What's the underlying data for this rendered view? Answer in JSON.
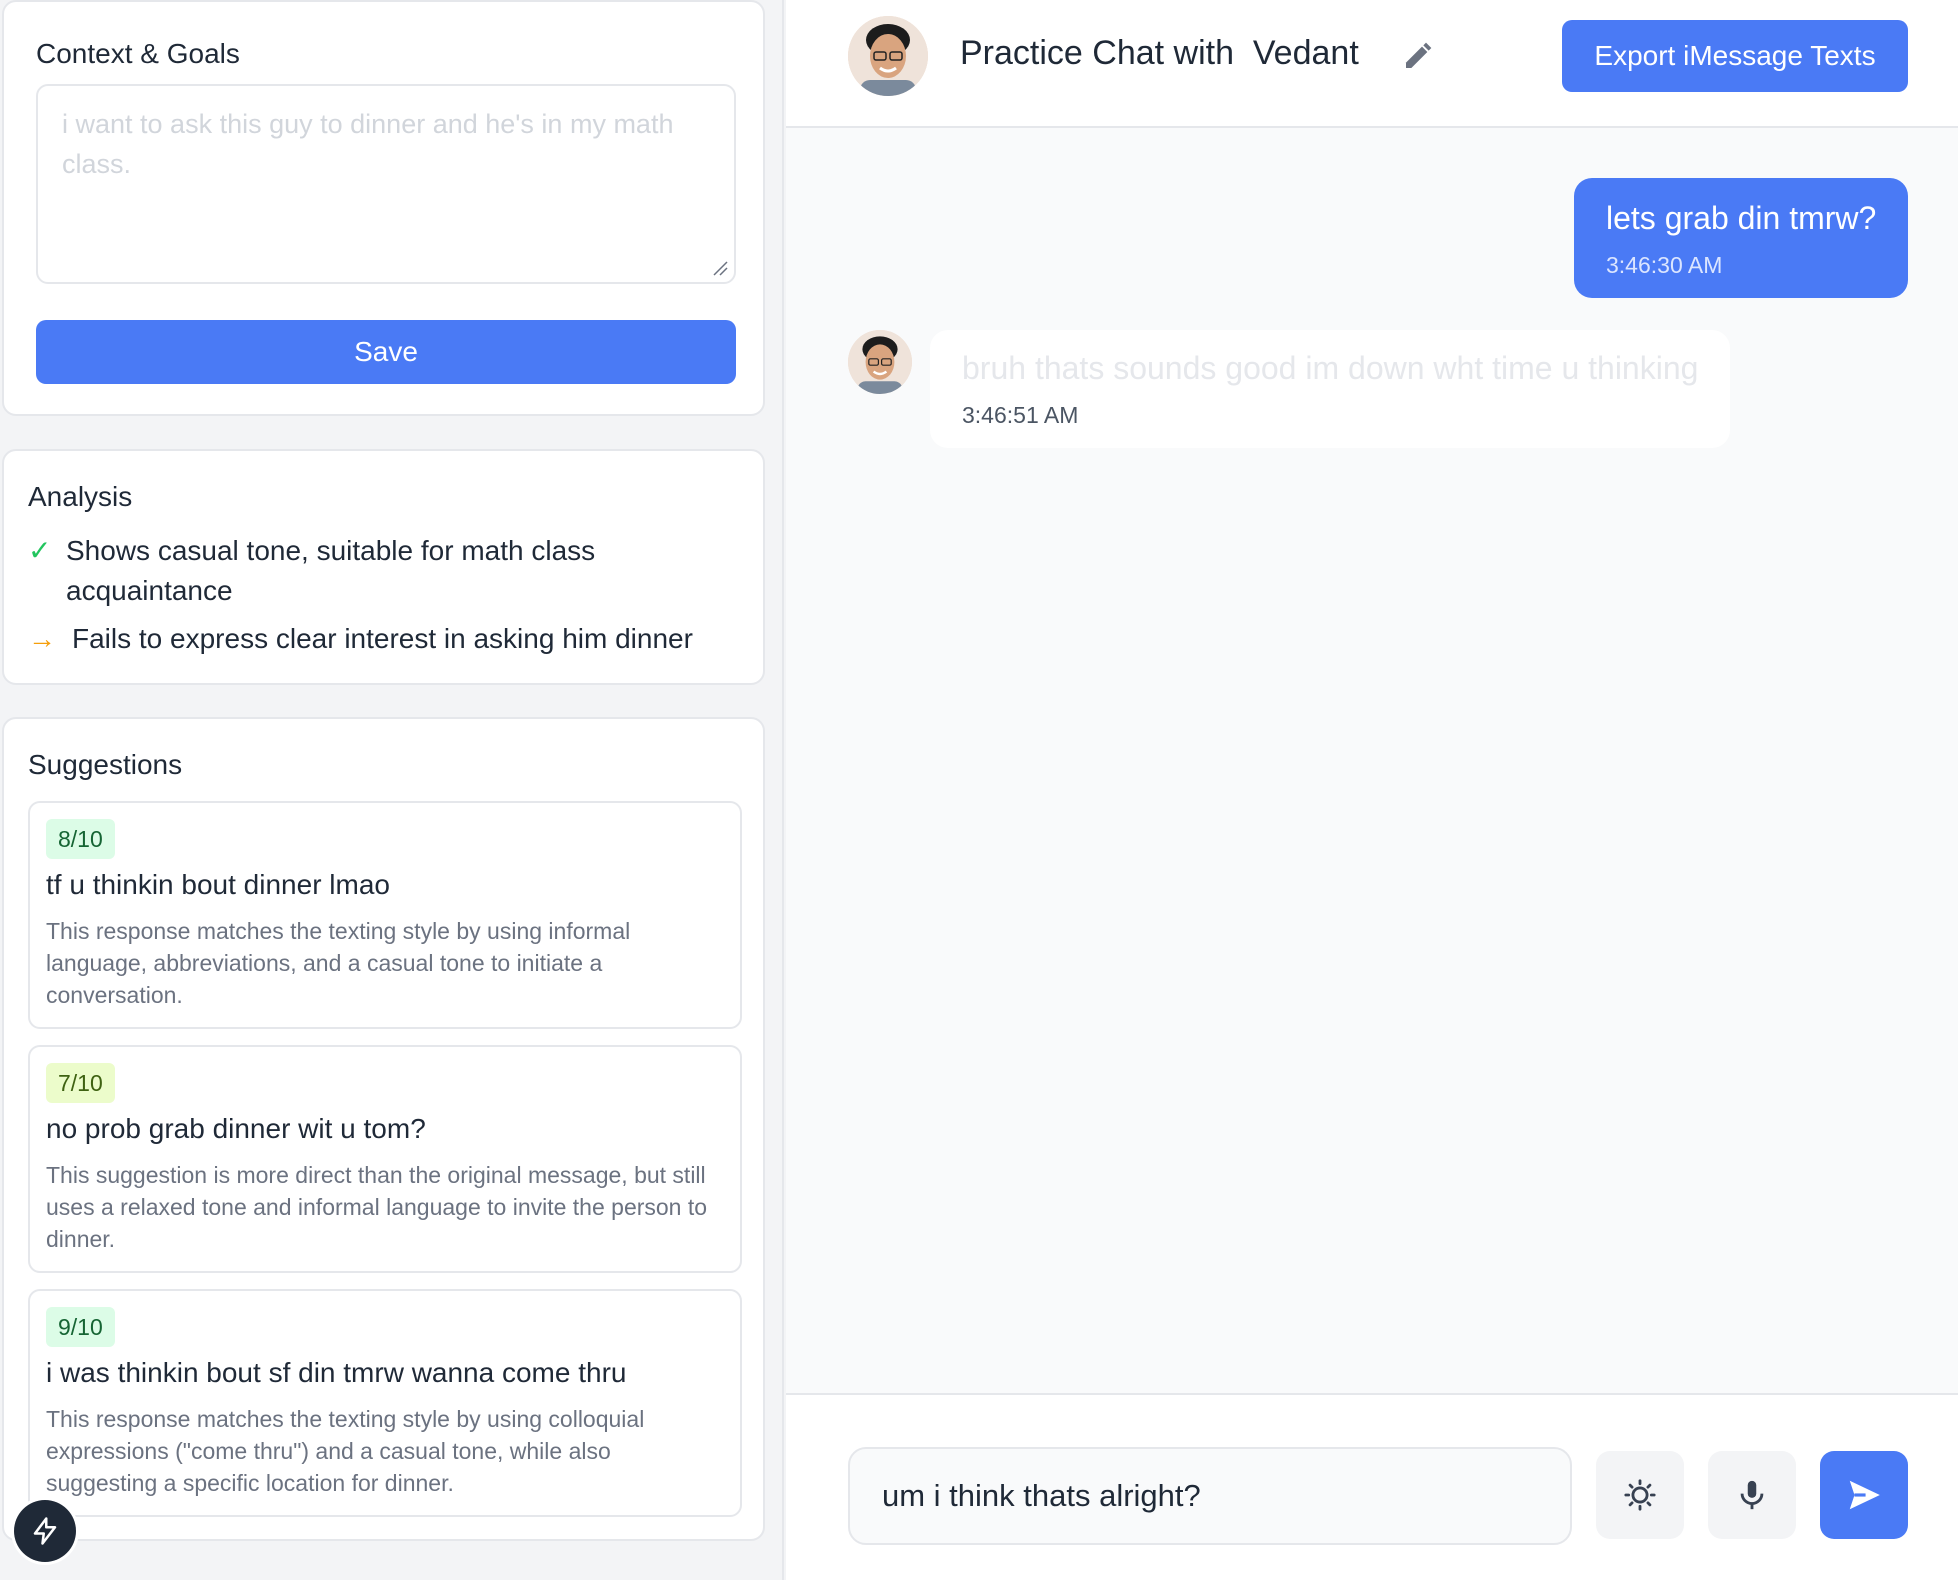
{
  "context": {
    "title": "Context & Goals",
    "placeholder": "i want to ask this guy to dinner and he's in my math class.",
    "value": "",
    "save_label": "Save"
  },
  "analysis": {
    "title": "Analysis",
    "items": [
      {
        "icon": "check-icon",
        "color": "#22c55e",
        "symbol": "✓",
        "text_line1": "Shows casual tone, suitable for math class",
        "text_line2": "acquaintance"
      },
      {
        "icon": "arrow-right-icon",
        "color": "#f59e0b",
        "symbol": "→",
        "text_line1": "Fails to express clear interest in asking him dinner"
      }
    ]
  },
  "suggestions": {
    "title": "Suggestions",
    "items": [
      {
        "score": "8/10",
        "text": "tf u thinkin bout dinner lmao",
        "description": "This response matches the texting style by using informal language, abbreviations, and a casual tone to initiate a conversation."
      },
      {
        "score": "7/10",
        "text": "no prob grab dinner wit u tom?",
        "description": "This suggestion is more direct than the original message, but still uses a relaxed tone and informal language to invite the person to dinner."
      },
      {
        "score": "9/10",
        "text": "i was thinkin bout sf din tmrw wanna come thru",
        "description": "This response matches the texting style by using colloquial expressions (\"come thru\") and a casual tone, while also suggesting a specific location for dinner."
      }
    ]
  },
  "chat": {
    "title": "Practice Chat with  Vedant",
    "export_label": "Export iMessage Texts",
    "messages": [
      {
        "from": "me",
        "text": "lets grab din tmrw?",
        "time": "3:46:30 AM"
      },
      {
        "from": "them",
        "text": "bruh thats sounds good im down wht time u thinking",
        "time": "3:46:51 AM"
      }
    ],
    "input_value": "um i think thats alright?"
  },
  "colors": {
    "accent": "#4a7af5",
    "check": "#22c55e",
    "arrow": "#f59e0b"
  },
  "icons": [
    "pencil-icon",
    "sun-icon",
    "mic-icon",
    "send-icon",
    "bolt-icon",
    "resize-handle-icon"
  ]
}
